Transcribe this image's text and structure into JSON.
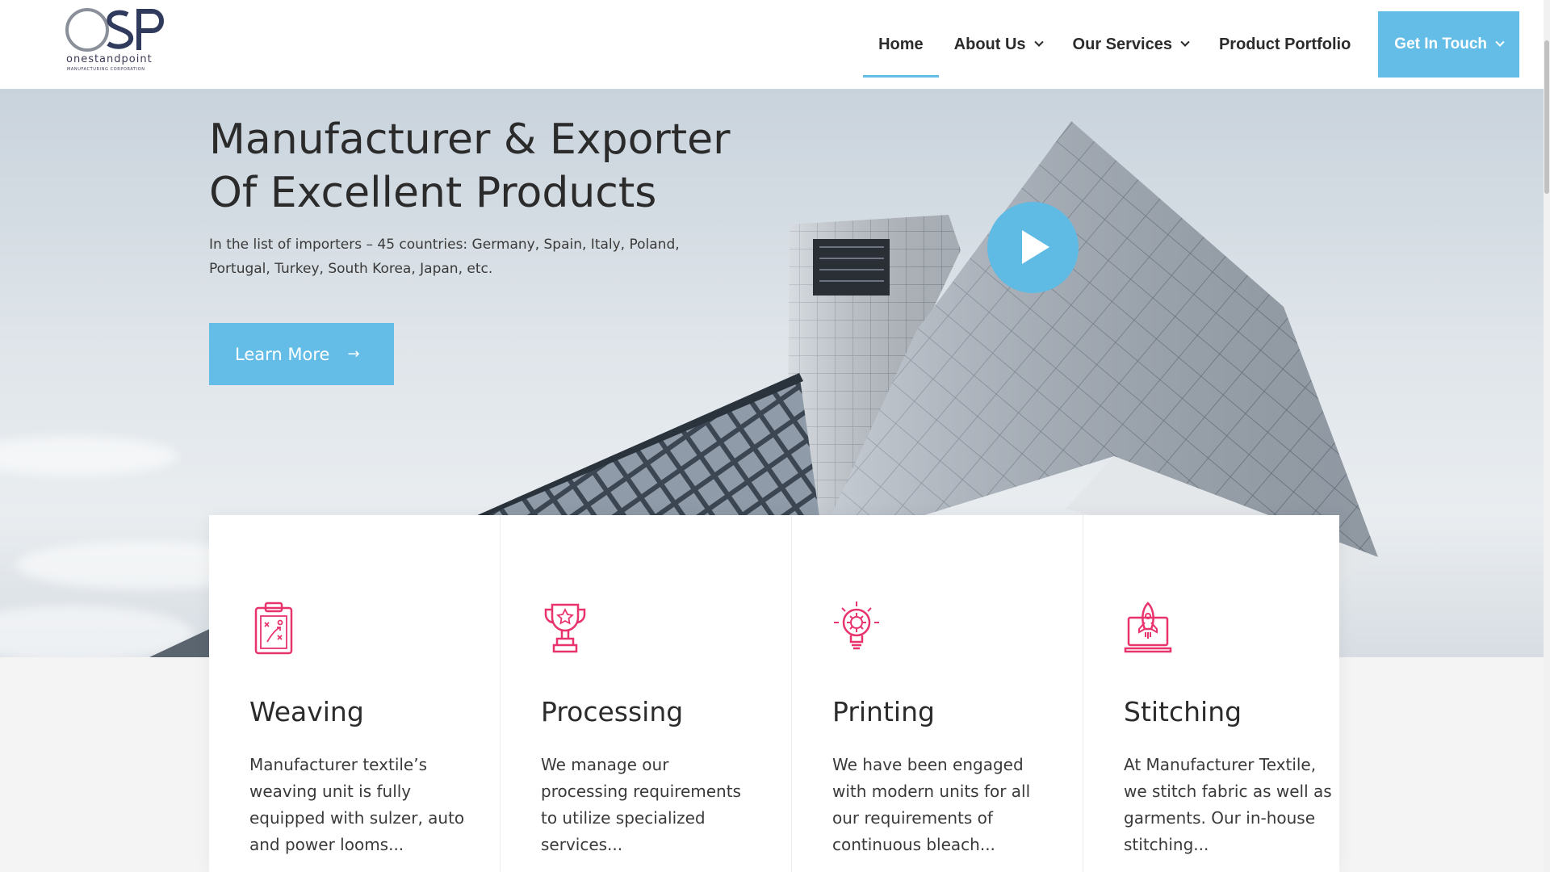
{
  "brand": {
    "logo_letters": "OSP",
    "logo_name": "onestandpoint",
    "logo_tagline": "MANUFACTURING CORPORATION",
    "accent_color": "#63bde6",
    "icon_color": "#e8336d"
  },
  "nav": {
    "items": [
      {
        "label": "Home",
        "active": true,
        "dropdown": false
      },
      {
        "label": "About Us",
        "active": false,
        "dropdown": true
      },
      {
        "label": "Our Services",
        "active": false,
        "dropdown": true
      },
      {
        "label": "Product Portfolio",
        "active": false,
        "dropdown": false
      }
    ],
    "cta_label": "Get In Touch"
  },
  "hero": {
    "title_line1": "Manufacturer & Exporter",
    "title_line2": "Of Excellent Products",
    "text": "In the list of importers – 45 countries: Germany, Spain, Italy, Poland, Portugal, Turkey, South Korea, Japan, etc.",
    "button_label": "Learn More",
    "button_icon": "arrow-right-icon",
    "play_icon": "play-icon"
  },
  "services": [
    {
      "icon": "clipboard-strategy-icon",
      "title": "Weaving",
      "text": "Manufacturer textile’s weaving unit is fully equipped with sulzer, auto and power looms..."
    },
    {
      "icon": "trophy-icon",
      "title": "Processing",
      "text": "We manage our processing requirements to utilize specialized services..."
    },
    {
      "icon": "lightbulb-gear-icon",
      "title": "Printing",
      "text": "We have been engaged with modern units for all our requirements of continuous bleach..."
    },
    {
      "icon": "rocket-laptop-icon",
      "title": "Stitching",
      "text": "At Manufacturer Textile, we stitch fabric as well as garments. Our in-house stitching..."
    }
  ]
}
